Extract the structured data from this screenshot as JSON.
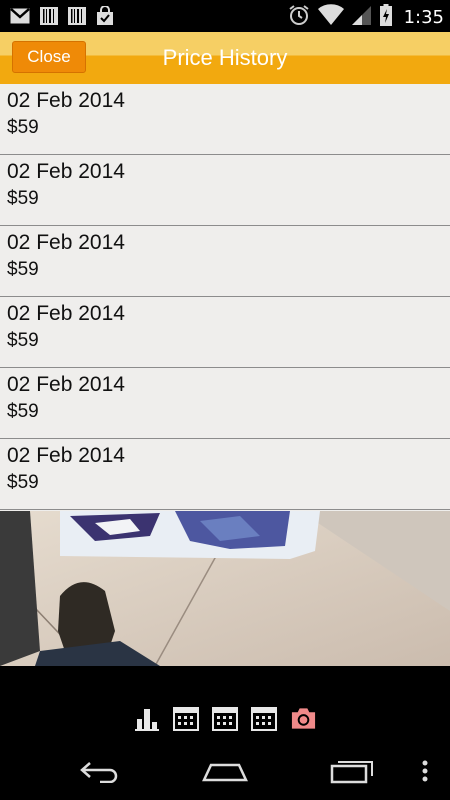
{
  "status_bar": {
    "time": "1:35",
    "left_icons": [
      "gmail-icon",
      "barcode-icon",
      "barcode-icon",
      "shopping-bag-icon"
    ],
    "right_icons": [
      "alarm-icon",
      "wifi-icon",
      "signal-icon",
      "battery-charging-icon"
    ]
  },
  "action_bar": {
    "close_label": "Close",
    "title": "Price History"
  },
  "history": [
    {
      "date": "02 Feb 2014",
      "price": "$59"
    },
    {
      "date": "02 Feb 2014",
      "price": "$59"
    },
    {
      "date": "02 Feb 2014",
      "price": "$59"
    },
    {
      "date": "02 Feb 2014",
      "price": "$59"
    },
    {
      "date": "02 Feb 2014",
      "price": "$59"
    },
    {
      "date": "02 Feb 2014",
      "price": "$59"
    }
  ],
  "toolbar": {
    "icons": [
      "bar-chart-icon",
      "calendar-icon",
      "calendar-icon",
      "calendar-icon",
      "camera-icon"
    ]
  },
  "nav_bar": {
    "icons": [
      "back-icon",
      "home-icon",
      "recent-apps-icon",
      "menu-icon"
    ]
  },
  "colors": {
    "action_bar_top": "#f6cf64",
    "action_bar_bottom": "#f2a90f",
    "close_button": "#ef8a07",
    "list_background": "#efeeec",
    "camera_icon": "#f08a8a"
  }
}
